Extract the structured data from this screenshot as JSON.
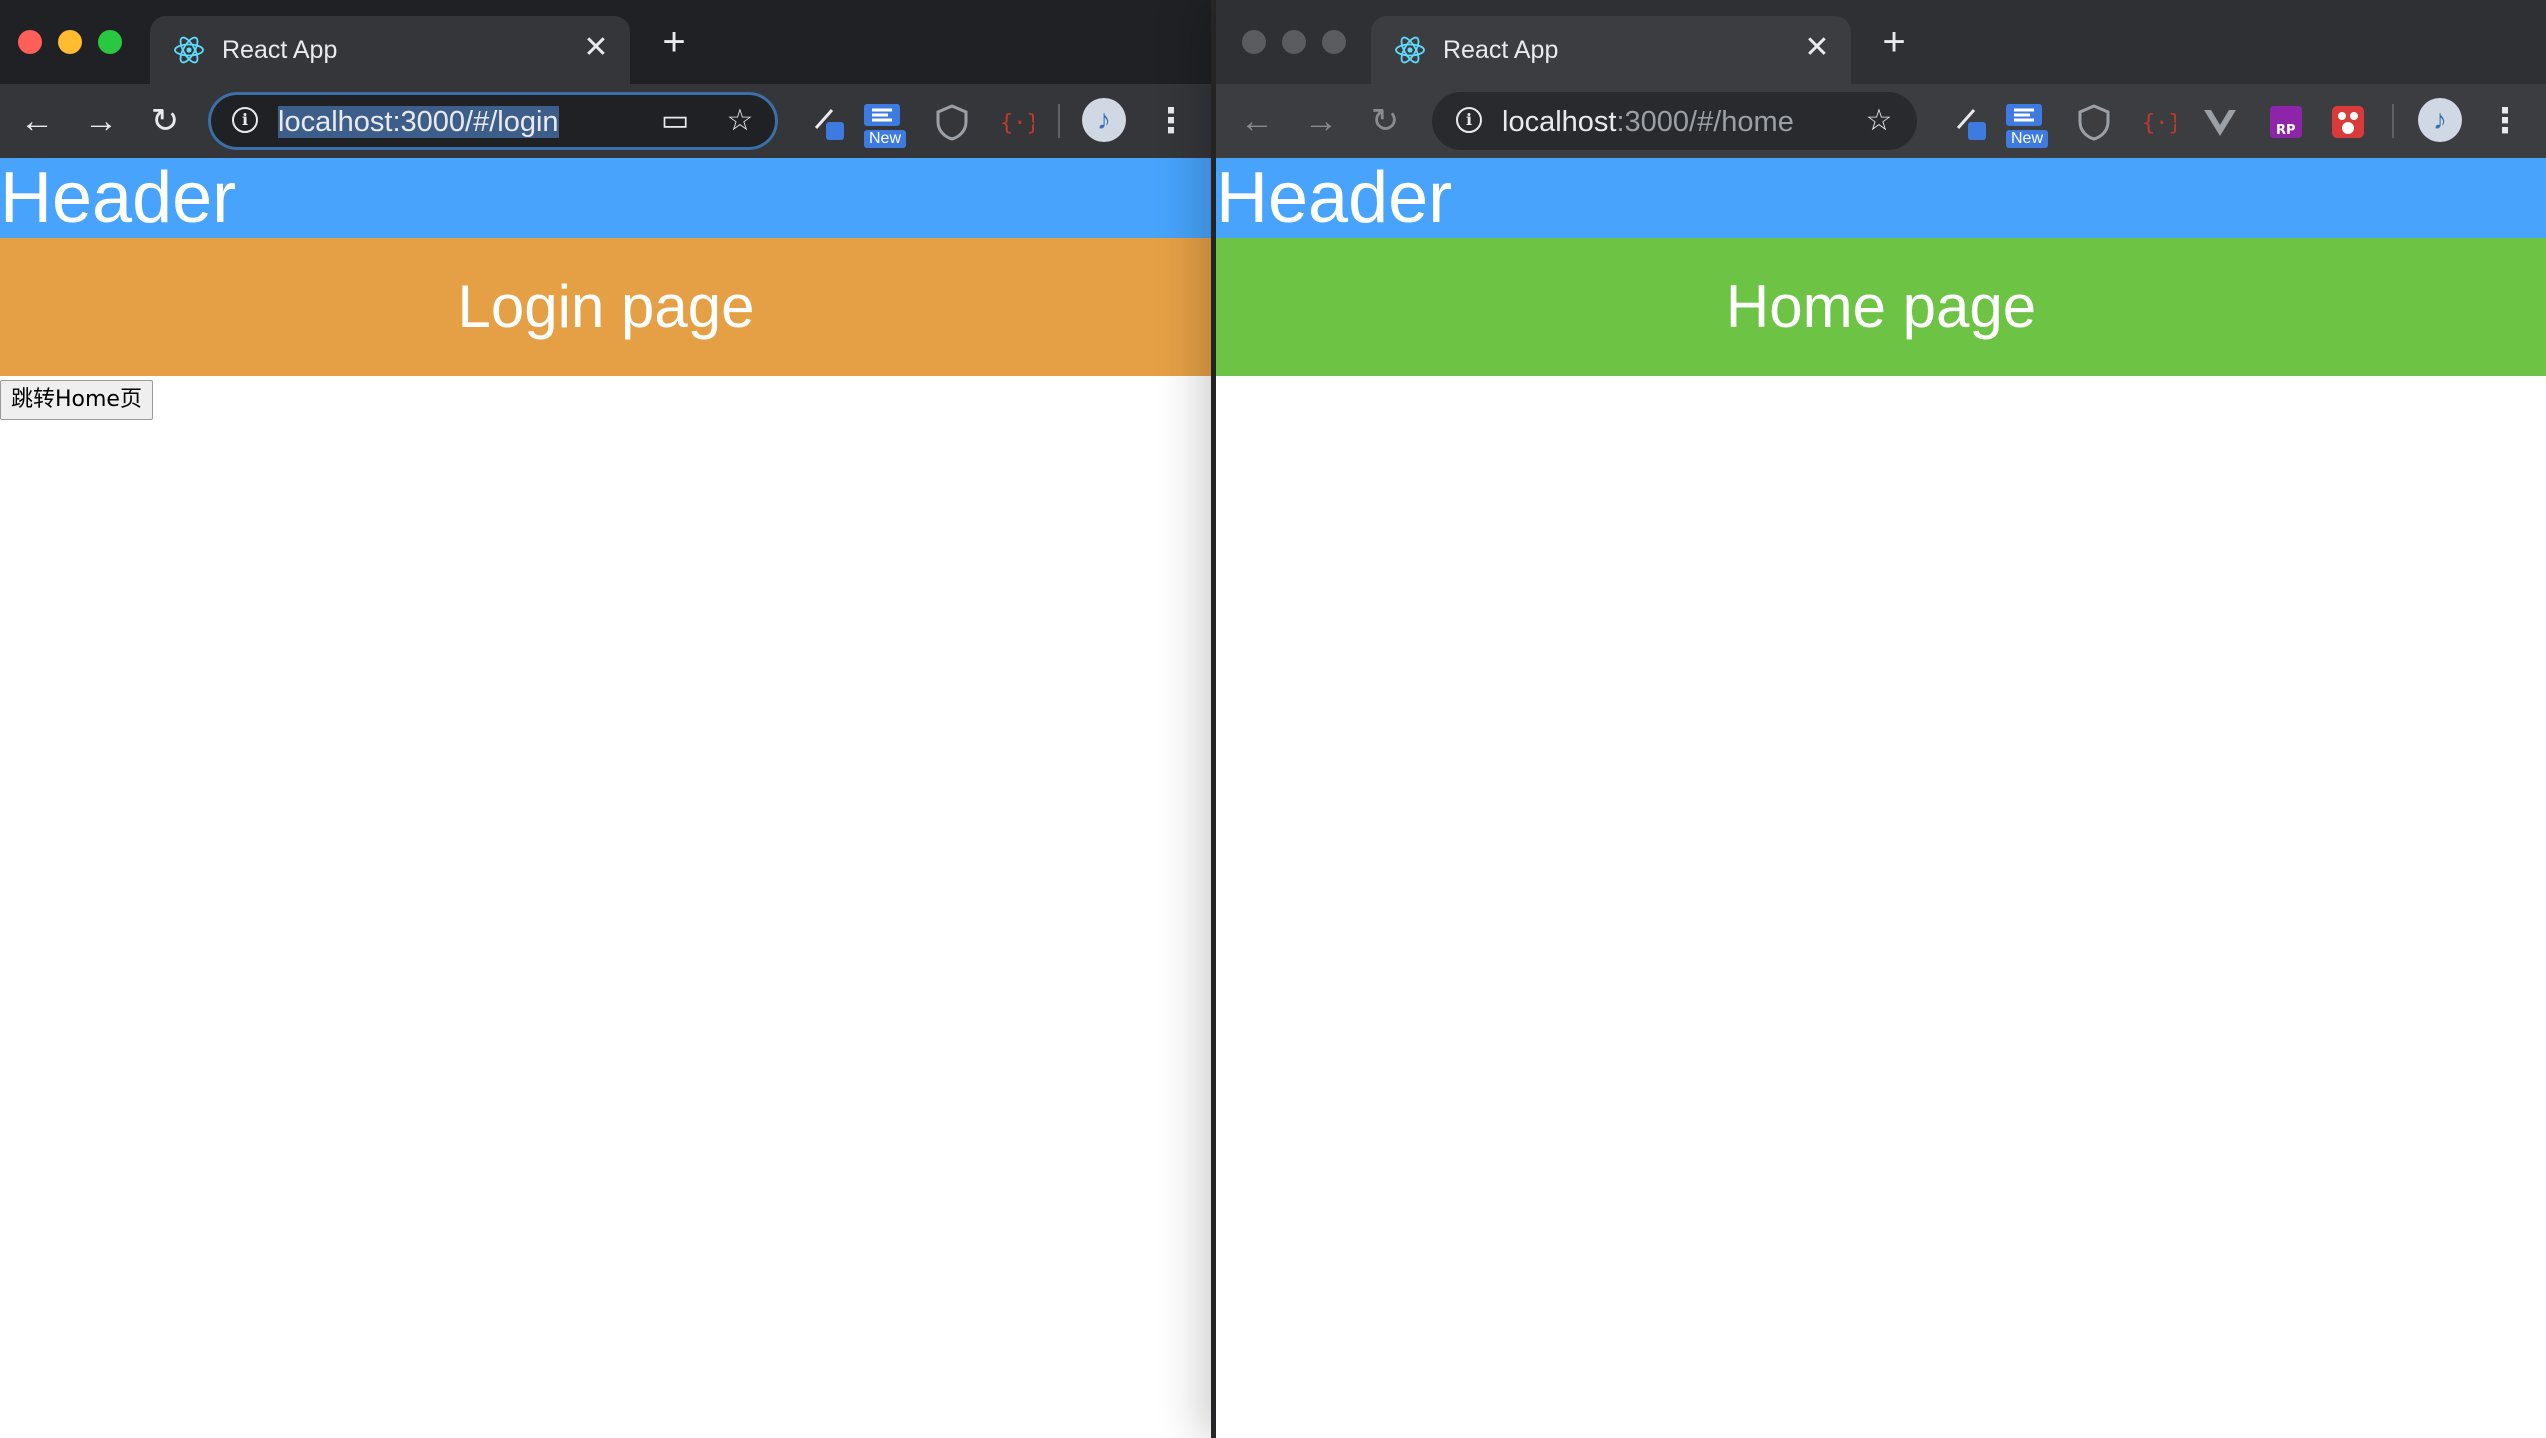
{
  "colors": {
    "header_bg": "#47a3fb",
    "login_banner_bg": "#e5a045",
    "home_banner_bg": "#6cc344",
    "chrome_dark": "#202124"
  },
  "left_window": {
    "tab": {
      "title": "React App",
      "icon": "react-logo-icon"
    },
    "address_bar": {
      "url": "localhost:3000/#/login"
    },
    "page": {
      "header_text": "Header",
      "banner_text": "Login page",
      "button_label": "跳转Home页"
    }
  },
  "right_window": {
    "tab": {
      "title": "React App",
      "icon": "react-logo-icon"
    },
    "address_bar": {
      "url_host": "localhost",
      "url_rest": ":3000/#/home"
    },
    "extensions": {
      "new_badge": "New"
    },
    "page": {
      "header_text": "Header",
      "banner_text": "Home page"
    }
  },
  "left_extensions": {
    "new_badge": "New"
  }
}
